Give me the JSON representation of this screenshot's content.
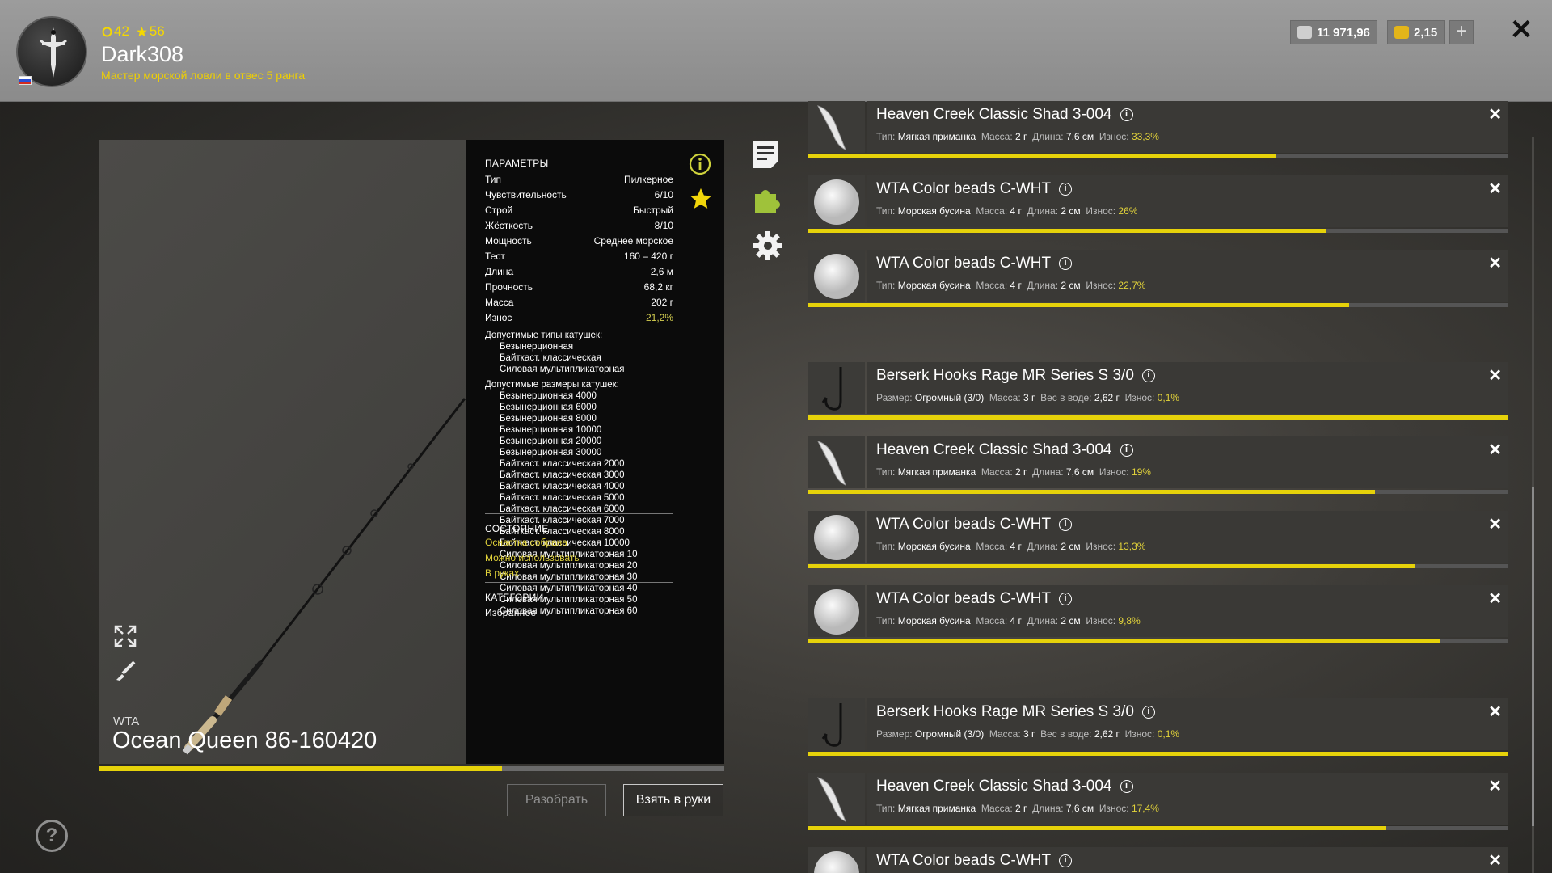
{
  "player": {
    "level": "42",
    "stars": "56",
    "nickname": "Dark308",
    "rank": "Мастер морской ловли в отвес 5 ранга"
  },
  "currency": {
    "silver": "11 971,96",
    "gold": "2,15"
  },
  "rod": {
    "brand": "WTA",
    "name": "Ocean Queen 86-160420",
    "wear_fraction": 0.644
  },
  "params": {
    "title": "ПАРАМЕТРЫ",
    "rows": [
      {
        "label": "Тип",
        "value": "Пилкерное"
      },
      {
        "label": "Чувствительность",
        "value": "6/10"
      },
      {
        "label": "Строй",
        "value": "Быстрый"
      },
      {
        "label": "Жёсткость",
        "value": "8/10"
      },
      {
        "label": "Мощность",
        "value": "Среднее морское"
      },
      {
        "label": "Тест",
        "value": "160 – 420 г"
      },
      {
        "label": "Длина",
        "value": "2,6 м"
      },
      {
        "label": "Прочность",
        "value": "68,2 кг"
      },
      {
        "label": "Масса",
        "value": "202 г"
      },
      {
        "label": "Износ",
        "value": "21,2%"
      }
    ],
    "reel_types_title": "Допустимые типы катушек:",
    "reel_types": [
      "Безынерционная",
      "Байткаст. классическая",
      "Силовая мультипликаторная"
    ],
    "reel_sizes_title": "Допустимые размеры катушек:",
    "reel_sizes": [
      "Безынерционная 4000",
      "Безынерционная 6000",
      "Безынерционная 8000",
      "Безынерционная 10000",
      "Безынерционная 20000",
      "Безынерционная 30000",
      "Байткаст. классическая 2000",
      "Байткаст. классическая 3000",
      "Байткаст. классическая 4000",
      "Байткаст. классическая 5000",
      "Байткаст. классическая 6000",
      "Байткаст. классическая 7000",
      "Байткаст. классическая 8000",
      "Байткаст. классическая 10000",
      "Силовая мультипликаторная 10",
      "Силовая мультипликаторная 20",
      "Силовая мультипликаторная 30",
      "Силовая мультипликаторная 40",
      "Силовая мультипликаторная 50",
      "Силовая мультипликаторная 60"
    ],
    "state_title": "СОСТОЯНИЕ",
    "state": [
      "Оснастка собрана",
      "Можно использовать",
      "В руках"
    ],
    "categories_title": "КАТЕГОРИИ",
    "category": "Избранное"
  },
  "buttons": {
    "disassemble": "Разобрать",
    "take": "Взять в руки"
  },
  "items": [
    {
      "name": "Heaven Creek Classic Shad 3-004",
      "kind": "lure",
      "k1": "Тип:",
      "v1": "Мягкая приманка",
      "k2": "Масса:",
      "v2": "2 г",
      "k3": "Длина:",
      "v3": "7,6 см",
      "k4": "Износ:",
      "v4": "33,3%",
      "wear": 0.667
    },
    {
      "name": "WTA Color beads C-WHT",
      "kind": "bead",
      "k1": "Тип:",
      "v1": "Морская бусина",
      "k2": "Масса:",
      "v2": "4 г",
      "k3": "Длина:",
      "v3": "2 см",
      "k4": "Износ:",
      "v4": "26%",
      "wear": 0.74
    },
    {
      "name": "WTA Color beads C-WHT",
      "kind": "bead",
      "k1": "Тип:",
      "v1": "Морская бусина",
      "k2": "Масса:",
      "v2": "4 г",
      "k3": "Длина:",
      "v3": "2 см",
      "k4": "Износ:",
      "v4": "22,7%",
      "wear": 0.773
    },
    {
      "name": "Berserk Hooks Rage MR Series S 3/0",
      "kind": "hook",
      "k1": "Размер:",
      "v1": "Огромный (3/0)",
      "k2": "Масса:",
      "v2": "3 г",
      "k3": "Вес в воде:",
      "v3": "2,62 г",
      "k4": "Износ:",
      "v4": "0,1%",
      "wear": 0.999
    },
    {
      "name": "Heaven Creek Classic Shad 3-004",
      "kind": "lure",
      "k1": "Тип:",
      "v1": "Мягкая приманка",
      "k2": "Масса:",
      "v2": "2 г",
      "k3": "Длина:",
      "v3": "7,6 см",
      "k4": "Износ:",
      "v4": "19%",
      "wear": 0.81
    },
    {
      "name": "WTA Color beads C-WHT",
      "kind": "bead",
      "k1": "Тип:",
      "v1": "Морская бусина",
      "k2": "Масса:",
      "v2": "4 г",
      "k3": "Длина:",
      "v3": "2 см",
      "k4": "Износ:",
      "v4": "13,3%",
      "wear": 0.867
    },
    {
      "name": "WTA Color beads C-WHT",
      "kind": "bead",
      "k1": "Тип:",
      "v1": "Морская бусина",
      "k2": "Масса:",
      "v2": "4 г",
      "k3": "Длина:",
      "v3": "2 см",
      "k4": "Износ:",
      "v4": "9,8%",
      "wear": 0.902
    },
    {
      "name": "Berserk Hooks Rage MR Series S 3/0",
      "kind": "hook",
      "k1": "Размер:",
      "v1": "Огромный (3/0)",
      "k2": "Масса:",
      "v2": "3 г",
      "k3": "Вес в воде:",
      "v3": "2,62 г",
      "k4": "Износ:",
      "v4": "0,1%",
      "wear": 0.999
    },
    {
      "name": "Heaven Creek Classic Shad 3-004",
      "kind": "lure",
      "k1": "Тип:",
      "v1": "Мягкая приманка",
      "k2": "Масса:",
      "v2": "2 г",
      "k3": "Длина:",
      "v3": "7,6 см",
      "k4": "Износ:",
      "v4": "17,4%",
      "wear": 0.826
    },
    {
      "name": "WTA Color beads C-WHT",
      "kind": "bead",
      "k1": "",
      "v1": "",
      "k2": "",
      "v2": "",
      "k3": "",
      "v3": "",
      "k4": "",
      "v4": "",
      "wear": 0
    }
  ],
  "colors": {
    "accent": "#e6d20a",
    "wear_text": "#e2d33a"
  },
  "icons": [
    "user-avatar-icon",
    "flag-ru-icon",
    "coin-silver-icon",
    "coin-gold-icon",
    "close-icon",
    "info-icon",
    "star-icon",
    "notes-icon",
    "puzzle-icon",
    "gear-icon",
    "expand-icon",
    "brush-icon",
    "help-icon"
  ]
}
